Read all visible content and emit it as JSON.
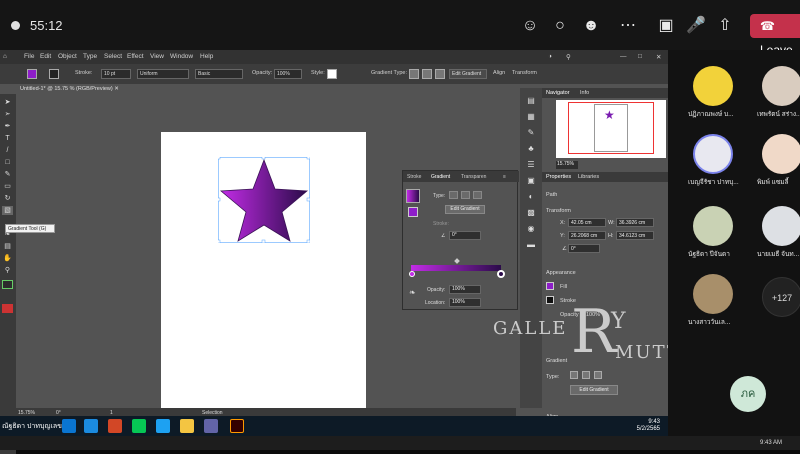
{
  "meeting": {
    "timer": "55:12",
    "leave_label": "Leave",
    "icons": [
      "people-icon",
      "chat-icon",
      "reactions-icon",
      "camera-off-icon",
      "mic-off-icon",
      "share-icon",
      "phone-icon"
    ]
  },
  "illustrator": {
    "menu": [
      "File",
      "Edit",
      "Object",
      "Type",
      "Select",
      "Effect",
      "View",
      "Window",
      "Help"
    ],
    "control": {
      "stroke_label": "Stroke:",
      "stroke_value": "10 pt",
      "uniform": "Uniform",
      "basic": "Basic",
      "opacity_label": "Opacity:",
      "opacity_value": "100%",
      "style_label": "Style:",
      "gradient_type_label": "Gradient Type:",
      "edit_gradient": "Edit Gradient",
      "align": "Align",
      "transform": "Transform"
    },
    "doc_tab": "Untitled-1* @ 15.75 % (RGB/Preview)",
    "tooltip": "Gradient Tool (G)",
    "gradient_panel": {
      "tabs": [
        "Stroke",
        "Gradient",
        "Transparen"
      ],
      "type_label": "Type:",
      "edit_gradient": "Edit Gradient",
      "stroke_label": "Stroke:",
      "angle_value": "0°",
      "opacity_label": "Opacity:",
      "opacity_value": "100%",
      "location_label": "Location:",
      "location_value": "100%",
      "colors": [
        "#c22ce6",
        "#2b0b4a"
      ]
    },
    "navigator": {
      "tabs": [
        "Navigator",
        "Info"
      ],
      "zoom": "15.75%"
    },
    "properties": {
      "tabs": [
        "Properties",
        "Libraries"
      ],
      "path_label": "Path",
      "transform_label": "Transform",
      "x_label": "X:",
      "x_value": "42.05 cm",
      "y_label": "Y:",
      "y_value": "26.2068 cm",
      "w_label": "W:",
      "w_value": "36.3926 cm",
      "h_label": "H:",
      "h_value": "34.6123 cm",
      "angle_value": "0°",
      "appearance_label": "Appearance",
      "fill_label": "Fill",
      "stroke_label": "Stroke",
      "opacity_label": "Opacity",
      "opacity_value": "100%",
      "gradient_label": "Gradient",
      "type_label": "Type:",
      "edit_gradient": "Edit Gradient",
      "align_label": "Align"
    },
    "status": {
      "zoom": "15.75%",
      "angle": "0°",
      "page": "1",
      "mode": "Selection"
    }
  },
  "taskbar": {
    "user_label": "ณัฐธิดา ปาทบุญเลข",
    "time": "9:43",
    "date": "5/2/2565"
  },
  "watermark": {
    "text1": "GALLE",
    "big": "R",
    "text2": "MUTT",
    "text3": "Y"
  },
  "participants": [
    {
      "name": "ปฏิภาณพงษ์ บ..."
    },
    {
      "name": "เทพรัตน์ สร่าง..."
    },
    {
      "name": "เบญจีรัชา ปาทบุ..."
    },
    {
      "name": "พิมพ์ แซมลี้"
    },
    {
      "name": "นัฐธิดา ปีจันดา"
    },
    {
      "name": "นายเมธี จันท..."
    },
    {
      "name": "นางสาววันเล..."
    }
  ],
  "more_count": "+127",
  "self_initials": "ภค",
  "system_time": "9:43 AM"
}
